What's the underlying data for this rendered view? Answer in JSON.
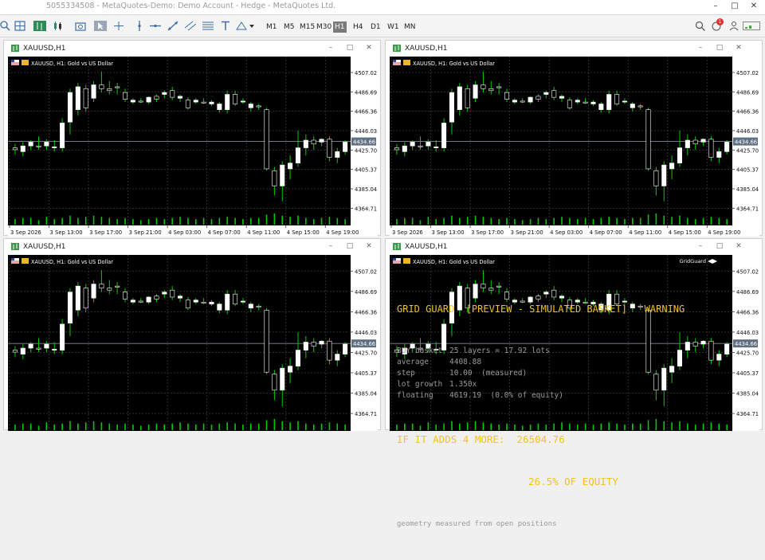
{
  "window": {
    "title": "5055334508 - MetaQuotes-Demo: Demo Account - Hedge - MetaQuotes Ltd."
  },
  "toolbar": {
    "timeframes": [
      "M1",
      "M5",
      "M15",
      "M30",
      "H1",
      "H4",
      "D1",
      "W1",
      "MN"
    ],
    "active_timeframe": "H1",
    "notification_count": "1"
  },
  "colors": {
    "chart_bg": "#000000",
    "candle": "#ffffff",
    "wick": "#00cc00",
    "grid": "#3a3a3a",
    "volume": "#00cc00",
    "hud_yellow": "#f0c419",
    "hud_grey": "#9a9a9a",
    "price_line": "#7f8a99"
  },
  "chart_common": {
    "symbol_label": "XAUUSD, H1:  Gold vs US Dollar",
    "price_levels": [
      "4507.02",
      "4486.69",
      "4466.36",
      "4446.03",
      "4425.70",
      "4405.37",
      "4385.04",
      "4364.71"
    ],
    "current_price": "4434.66",
    "time_labels": [
      "3 Sep 2026",
      "3 Sep 13:00",
      "3 Sep 17:00",
      "3 Sep 21:00",
      "4 Sep 03:00",
      "4 Sep 07:00",
      "4 Sep 11:00",
      "4 Sep 15:00",
      "4 Sep 19:00"
    ]
  },
  "charts": [
    {
      "title": "XAUUSD,H1",
      "show_time_axis": true,
      "indicator_label": ""
    },
    {
      "title": "XAUUSD,H1",
      "show_time_axis": true,
      "indicator_label": ""
    },
    {
      "title": "XAUUSD,H1",
      "show_time_axis": false,
      "indicator_label": ""
    },
    {
      "title": "XAUUSD,H1",
      "show_time_axis": false,
      "indicator_label": "GridGuard"
    }
  ],
  "chart_data": {
    "type": "candlestick",
    "symbol": "XAUUSD",
    "timeframe": "H1",
    "ylim": [
      4360,
      4512
    ],
    "candles": [
      {
        "o": 4428,
        "h": 4432,
        "l": 4421,
        "c": 4426
      },
      {
        "o": 4424,
        "h": 4434,
        "l": 4419,
        "c": 4430
      },
      {
        "o": 4430,
        "h": 4436,
        "l": 4426,
        "c": 4434
      },
      {
        "o": 4430,
        "h": 4440,
        "l": 4426,
        "c": 4429
      },
      {
        "o": 4430,
        "h": 4437,
        "l": 4426,
        "c": 4434
      },
      {
        "o": 4428,
        "h": 4436,
        "l": 4424,
        "c": 4429
      },
      {
        "o": 4428,
        "h": 4459,
        "l": 4424,
        "c": 4454
      },
      {
        "o": 4455,
        "h": 4490,
        "l": 4442,
        "c": 4486
      },
      {
        "o": 4468,
        "h": 4496,
        "l": 4462,
        "c": 4492
      },
      {
        "o": 4490,
        "h": 4494,
        "l": 4466,
        "c": 4470
      },
      {
        "o": 4480,
        "h": 4498,
        "l": 4476,
        "c": 4494
      },
      {
        "o": 4494,
        "h": 4508,
        "l": 4486,
        "c": 4490
      },
      {
        "o": 4490,
        "h": 4498,
        "l": 4484,
        "c": 4488
      },
      {
        "o": 4492,
        "h": 4496,
        "l": 4484,
        "c": 4491
      },
      {
        "o": 4486,
        "h": 4490,
        "l": 4476,
        "c": 4479
      },
      {
        "o": 4476,
        "h": 4480,
        "l": 4474,
        "c": 4478
      },
      {
        "o": 4477,
        "h": 4480,
        "l": 4475,
        "c": 4476
      },
      {
        "o": 4476,
        "h": 4482,
        "l": 4474,
        "c": 4481
      },
      {
        "o": 4482,
        "h": 4484,
        "l": 4476,
        "c": 4479
      },
      {
        "o": 4484,
        "h": 4488,
        "l": 4480,
        "c": 4486
      },
      {
        "o": 4488,
        "h": 4492,
        "l": 4478,
        "c": 4481
      },
      {
        "o": 4480,
        "h": 4484,
        "l": 4476,
        "c": 4482
      },
      {
        "o": 4478,
        "h": 4481,
        "l": 4468,
        "c": 4470
      },
      {
        "o": 4476,
        "h": 4480,
        "l": 4474,
        "c": 4478
      },
      {
        "o": 4476,
        "h": 4480,
        "l": 4474,
        "c": 4475
      },
      {
        "o": 4474,
        "h": 4478,
        "l": 4472,
        "c": 4476
      },
      {
        "o": 4468,
        "h": 4476,
        "l": 4465,
        "c": 4474
      },
      {
        "o": 4468,
        "h": 4488,
        "l": 4464,
        "c": 4484
      },
      {
        "o": 4484,
        "h": 4488,
        "l": 4472,
        "c": 4474
      },
      {
        "o": 4476,
        "h": 4480,
        "l": 4474,
        "c": 4477
      },
      {
        "o": 4470,
        "h": 4476,
        "l": 4466,
        "c": 4474
      },
      {
        "o": 4472,
        "h": 4474,
        "l": 4468,
        "c": 4471
      },
      {
        "o": 4468,
        "h": 4470,
        "l": 4404,
        "c": 4406
      },
      {
        "o": 4404,
        "h": 4408,
        "l": 4378,
        "c": 4388
      },
      {
        "o": 4388,
        "h": 4414,
        "l": 4372,
        "c": 4410
      },
      {
        "o": 4406,
        "h": 4420,
        "l": 4395,
        "c": 4412
      },
      {
        "o": 4412,
        "h": 4446,
        "l": 4408,
        "c": 4428
      },
      {
        "o": 4428,
        "h": 4442,
        "l": 4420,
        "c": 4436
      },
      {
        "o": 4436,
        "h": 4440,
        "l": 4426,
        "c": 4432
      },
      {
        "o": 4434,
        "h": 4438,
        "l": 4430,
        "c": 4437
      },
      {
        "o": 4437,
        "h": 4440,
        "l": 4414,
        "c": 4418
      },
      {
        "o": 4418,
        "h": 4428,
        "l": 4412,
        "c": 4424
      },
      {
        "o": 4424,
        "h": 4436,
        "l": 4421,
        "c": 4434
      }
    ],
    "volumes": [
      5,
      6,
      6,
      4,
      7,
      5,
      6,
      8,
      6,
      7,
      8,
      7,
      6,
      5,
      6,
      5,
      4,
      5,
      6,
      5,
      6,
      7,
      6,
      5,
      6,
      5,
      6,
      7,
      6,
      5,
      6,
      6,
      9,
      10,
      8,
      7,
      8,
      6,
      5,
      6,
      7,
      6,
      5
    ]
  },
  "hud": {
    "heading": "GRID GUARD  [PREVIEW - SIMULATED BASKET]",
    "status": "WARNING",
    "rows": [
      {
        "label": "BUY basket",
        "value": "25 layers = 17.92 lots"
      },
      {
        "label": "average",
        "value": "4408.88"
      },
      {
        "label": "step",
        "value": "10.00  (measured)"
      },
      {
        "label": "lot growth",
        "value": "1.350x"
      },
      {
        "label": "floating",
        "value": "4619.19  (0.0% of equity)"
      }
    ],
    "warn_label": "IF IT ADDS 4 MORE:",
    "warn_amount": "26504.76",
    "warn_percent": "26.5% OF EQUITY",
    "footer": "geometry measured from open positions"
  }
}
